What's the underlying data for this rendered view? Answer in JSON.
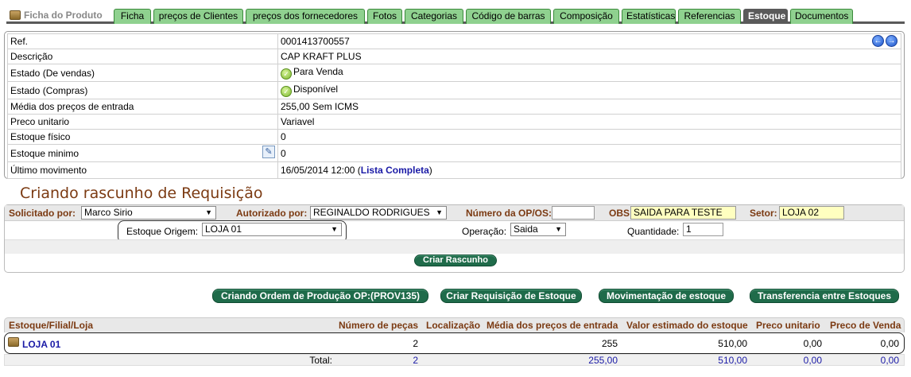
{
  "tabs": {
    "title": "Ficha do Produto",
    "items": [
      "Ficha",
      "preços de Clientes",
      "preços dos fornecedores",
      "Fotos",
      "Categorias",
      "Código de barras",
      "Composição",
      "Estatísticas",
      "Referencias",
      "Estoque",
      "Documentos"
    ],
    "active": "Estoque"
  },
  "info": {
    "ref_label": "Ref.",
    "ref_value": "0001413700557",
    "desc_label": "Descrição",
    "desc_value": "CAP KRAFT PLUS",
    "estado_vendas_label": "Estado (De vendas)",
    "estado_vendas_value": "Para Venda",
    "estado_compras_label": "Estado (Compras)",
    "estado_compras_value": "Disponível",
    "media_label": "Média dos preços de entrada",
    "media_value": "255,00 Sem ICMS",
    "preco_label": "Preco unitario",
    "preco_value": "Variavel",
    "fisico_label": "Estoque físico",
    "fisico_value": "0",
    "minimo_label": "Estoque minimo",
    "minimo_value": "0",
    "ultimo_label": "Último movimento",
    "ultimo_date": "16/05/2014 12:00",
    "ultimo_link": "Lista Completa"
  },
  "requisicao": {
    "title": "Criando rascunho de Requisição",
    "solicitado_label": "Solicitado por:",
    "solicitado_value": "Marco Sirio",
    "autorizado_label": "Autorizado por:",
    "autorizado_value": "REGINALDO RODRIGUES",
    "op_label": "Número da OP/OS:",
    "op_value": "",
    "obs_label": "OBS:",
    "obs_value": "SAIDA PARA TESTE",
    "setor_label": "Setor:",
    "setor_value": "LOJA 02",
    "origem_label": "Estoque Origem:",
    "origem_value": "LOJA 01",
    "operacao_label": "Operação:",
    "operacao_value": "Saida",
    "quantidade_label": "Quantidade:",
    "quantidade_value": "1",
    "criar_button": "Criar Rascunho"
  },
  "actions": {
    "ordem_producao": "Criando Ordem de Produção OP:(PROV135)",
    "criar_requisicao": "Criar Requisição de Estoque",
    "movimentacao": "Movimentação de estoque",
    "transferencia": "Transferencia entre Estoques"
  },
  "stock": {
    "headers": [
      "Estoque/Filial/Loja",
      "Número de peças",
      "Localização",
      "Média dos preços de entrada",
      "Valor estimado do estoque",
      "Preco unitario",
      "Preco de Venda"
    ],
    "row": {
      "name": "LOJA 01",
      "pecas": "2",
      "localizacao": "",
      "media": "255",
      "valor": "510,00",
      "unitario": "0,00",
      "venda": "0,00"
    },
    "total": {
      "label": "Total:",
      "pecas": "2",
      "media": "255,00",
      "valor": "510,00",
      "unitario": "0,00",
      "venda": "0,00"
    }
  }
}
